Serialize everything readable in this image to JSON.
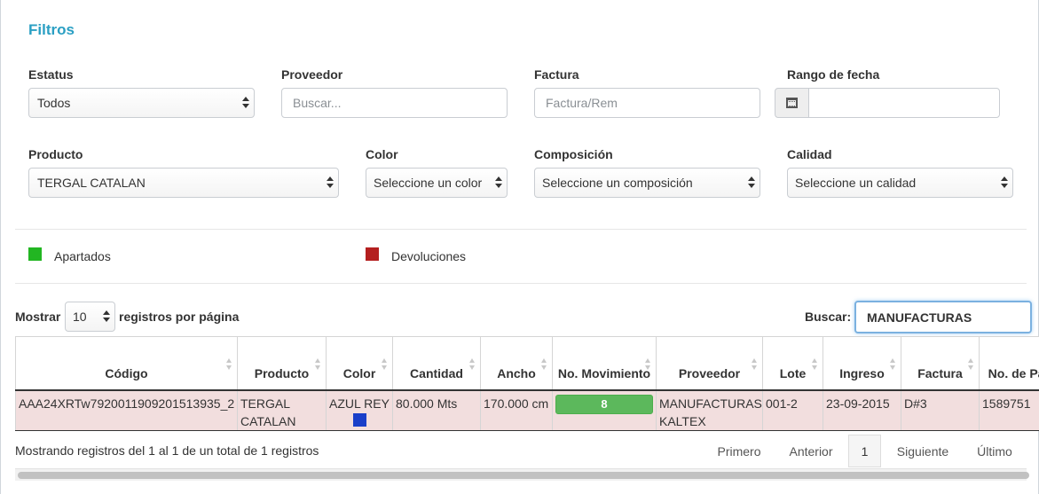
{
  "filters": {
    "title": "Filtros",
    "estatus": {
      "label": "Estatus",
      "value": "Todos"
    },
    "proveedor": {
      "label": "Proveedor",
      "placeholder": "Buscar..."
    },
    "factura": {
      "label": "Factura",
      "placeholder": "Factura/Rem"
    },
    "rango_fecha": {
      "label": "Rango de fecha",
      "value": ""
    },
    "producto": {
      "label": "Producto",
      "value": "TERGAL CATALAN"
    },
    "color": {
      "label": "Color",
      "value": "Seleccione un color"
    },
    "composicion": {
      "label": "Composición",
      "value": "Seleccione un composición"
    },
    "calidad": {
      "label": "Calidad",
      "value": "Seleccione un calidad"
    }
  },
  "legend": [
    {
      "label": "Apartados",
      "color": "#22b622"
    },
    {
      "label": "Devoluciones",
      "color": "#b41f1f"
    }
  ],
  "table_controls": {
    "show_label": "Mostrar",
    "page_size": "10",
    "per_page_label": "registros por página",
    "search_label": "Buscar:",
    "search_value": "MANUFACTURAS"
  },
  "columns": [
    "Código",
    "Producto",
    "Color",
    "Cantidad",
    "Ancho",
    "No. Movimiento",
    "Proveedor",
    "Lote",
    "Ingreso",
    "Factura",
    "No. de Partida"
  ],
  "rows": [
    {
      "codigo": "AAA24XRTw7920011909201513935_2",
      "producto": "TERGAL CATALAN",
      "color": "AZUL REY",
      "color_swatch": "#1a3fc9",
      "cantidad": "80.000 Mts",
      "ancho": "170.000 cm",
      "movimiento": "8",
      "proveedor": "MANUFACTURAS KALTEX",
      "lote": "001-2",
      "ingreso": "23-09-2015",
      "factura": "D#3",
      "partida": "1589751"
    }
  ],
  "footer": {
    "info": "Mostrando registros del 1 al 1 de un total de 1 registros",
    "pagination": {
      "first": "Primero",
      "previous": "Anterior",
      "current": "1",
      "next": "Siguiente",
      "last": "Último"
    }
  }
}
